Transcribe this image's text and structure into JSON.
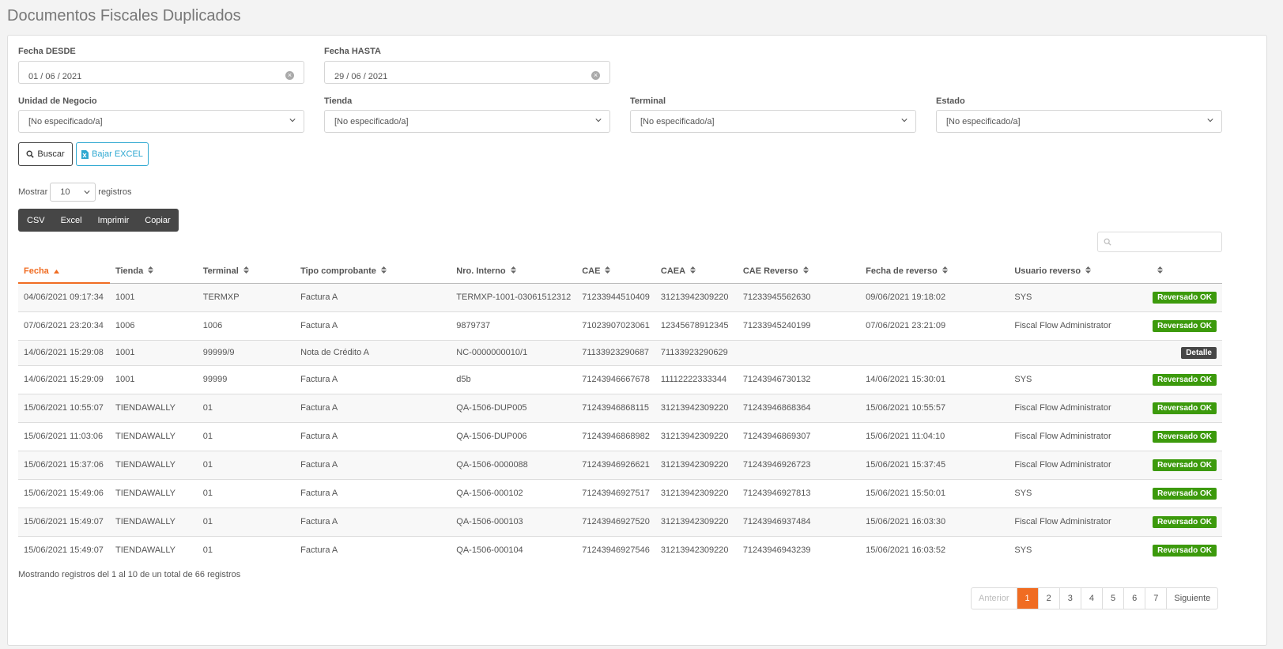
{
  "page": {
    "title": "Documentos Fiscales Duplicados"
  },
  "accent_color": "#f06c22",
  "filters": {
    "fecha_desde": {
      "label": "Fecha DESDE",
      "value": "01 / 06 / 2021"
    },
    "fecha_hasta": {
      "label": "Fecha HASTA",
      "value": "29 / 06 / 2021"
    },
    "unidad_negocio": {
      "label": "Unidad de Negocio",
      "value": "[No especificado/a]"
    },
    "tienda": {
      "label": "Tienda",
      "value": "[No especificado/a]"
    },
    "terminal": {
      "label": "Terminal",
      "value": "[No especificado/a]"
    },
    "estado": {
      "label": "Estado",
      "value": "[No especificado/a]"
    }
  },
  "actions": {
    "buscar": "Buscar",
    "bajar_excel": "Bajar EXCEL"
  },
  "length": {
    "prefix": "Mostrar",
    "value": "10",
    "suffix": "registros"
  },
  "export": {
    "csv": "CSV",
    "excel": "Excel",
    "imprimir": "Imprimir",
    "copiar": "Copiar"
  },
  "table": {
    "columns": [
      "Fecha",
      "Tienda",
      "Terminal",
      "Tipo comprobante",
      "Nro. Interno",
      "CAE",
      "CAEA",
      "CAE Reverso",
      "Fecha de reverso",
      "Usuario reverso",
      ""
    ],
    "sorted_column": "Fecha",
    "rows": [
      {
        "fecha": "04/06/2021 09:17:34",
        "tienda": "1001",
        "terminal": "TERMXP",
        "tipo": "Factura A",
        "nro": "TERMXP-1001-03061512312",
        "cae": "71233944510409",
        "caea": "31213942309220",
        "cae_rev": "71233945562630",
        "fecha_rev": "09/06/2021 19:18:02",
        "usuario": "SYS",
        "estado": "Reversado OK",
        "estado_color": "#3c9a0c"
      },
      {
        "fecha": "07/06/2021 23:20:34",
        "tienda": "1006",
        "terminal": "1006",
        "tipo": "Factura A",
        "nro": "9879737",
        "cae": "71023907023061",
        "caea": "12345678912345",
        "cae_rev": "71233945240199",
        "fecha_rev": "07/06/2021 23:21:09",
        "usuario": "Fiscal Flow Administrator",
        "estado": "Reversado OK",
        "estado_color": "#3c9a0c"
      },
      {
        "fecha": "14/06/2021 15:29:08",
        "tienda": "1001",
        "terminal": "99999/9",
        "tipo": "Nota de Crédito A",
        "nro": "NC-0000000010/1",
        "cae": "71133923290687",
        "caea": "71133923290629",
        "cae_rev": "",
        "fecha_rev": "",
        "usuario": "",
        "estado": "Detalle",
        "estado_color": "#464646"
      },
      {
        "fecha": "14/06/2021 15:29:09",
        "tienda": "1001",
        "terminal": "99999",
        "tipo": "Factura A",
        "nro": "d5b",
        "cae": "71243946667678",
        "caea": "11112222333344",
        "cae_rev": "71243946730132",
        "fecha_rev": "14/06/2021 15:30:01",
        "usuario": "SYS",
        "estado": "Reversado OK",
        "estado_color": "#3c9a0c"
      },
      {
        "fecha": "15/06/2021 10:55:07",
        "tienda": "TIENDAWALLY",
        "terminal": "01",
        "tipo": "Factura A",
        "nro": "QA-1506-DUP005",
        "cae": "71243946868115",
        "caea": "31213942309220",
        "cae_rev": "71243946868364",
        "fecha_rev": "15/06/2021 10:55:57",
        "usuario": "Fiscal Flow Administrator",
        "estado": "Reversado OK",
        "estado_color": "#3c9a0c"
      },
      {
        "fecha": "15/06/2021 11:03:06",
        "tienda": "TIENDAWALLY",
        "terminal": "01",
        "tipo": "Factura A",
        "nro": "QA-1506-DUP006",
        "cae": "71243946868982",
        "caea": "31213942309220",
        "cae_rev": "71243946869307",
        "fecha_rev": "15/06/2021 11:04:10",
        "usuario": "Fiscal Flow Administrator",
        "estado": "Reversado OK",
        "estado_color": "#3c9a0c"
      },
      {
        "fecha": "15/06/2021 15:37:06",
        "tienda": "TIENDAWALLY",
        "terminal": "01",
        "tipo": "Factura A",
        "nro": "QA-1506-0000088",
        "cae": "71243946926621",
        "caea": "31213942309220",
        "cae_rev": "71243946926723",
        "fecha_rev": "15/06/2021 15:37:45",
        "usuario": "Fiscal Flow Administrator",
        "estado": "Reversado OK",
        "estado_color": "#3c9a0c"
      },
      {
        "fecha": "15/06/2021 15:49:06",
        "tienda": "TIENDAWALLY",
        "terminal": "01",
        "tipo": "Factura A",
        "nro": "QA-1506-000102",
        "cae": "71243946927517",
        "caea": "31213942309220",
        "cae_rev": "71243946927813",
        "fecha_rev": "15/06/2021 15:50:01",
        "usuario": "SYS",
        "estado": "Reversado OK",
        "estado_color": "#3c9a0c"
      },
      {
        "fecha": "15/06/2021 15:49:07",
        "tienda": "TIENDAWALLY",
        "terminal": "01",
        "tipo": "Factura A",
        "nro": "QA-1506-000103",
        "cae": "71243946927520",
        "caea": "31213942309220",
        "cae_rev": "71243946937484",
        "fecha_rev": "15/06/2021 16:03:30",
        "usuario": "Fiscal Flow Administrator",
        "estado": "Reversado OK",
        "estado_color": "#3c9a0c"
      },
      {
        "fecha": "15/06/2021 15:49:07",
        "tienda": "TIENDAWALLY",
        "terminal": "01",
        "tipo": "Factura A",
        "nro": "QA-1506-000104",
        "cae": "71243946927546",
        "caea": "31213942309220",
        "cae_rev": "71243946943239",
        "fecha_rev": "15/06/2021 16:03:52",
        "usuario": "SYS",
        "estado": "Reversado OK",
        "estado_color": "#3c9a0c"
      }
    ]
  },
  "info": "Mostrando registros del 1 al 10 de un total de 66 registros",
  "pagination": {
    "previous": "Anterior",
    "pages": [
      "1",
      "2",
      "3",
      "4",
      "5",
      "6",
      "7"
    ],
    "active": "1",
    "next": "Siguiente"
  }
}
